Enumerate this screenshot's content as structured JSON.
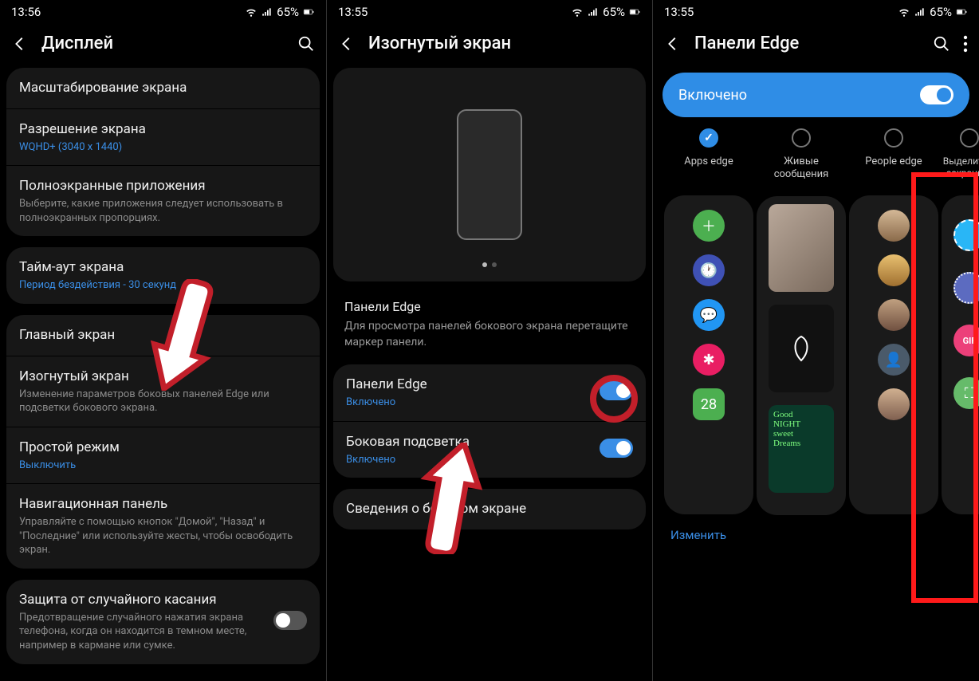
{
  "status": {
    "time1": "13:56",
    "time2": "13:55",
    "time3": "13:55",
    "battery": "65%"
  },
  "screen1": {
    "title": "Дисплей",
    "items": {
      "scaling": "Масштабирование экрана",
      "resolution": "Разрешение экрана",
      "resolution_sub": "WQHD+ (3040 x 1440)",
      "fullscreen": "Полноэкранные приложения",
      "fullscreen_sub": "Выберите, какие приложения следует использовать в полноэкранных пропорциях.",
      "timeout": "Тайм-аут экрана",
      "timeout_sub": "Период бездействия - 30 секунд",
      "home": "Главный экран",
      "edge": "Изогнутый экран",
      "edge_sub": "Изменение параметров боковых панелей Edge или подсветки бокового экрана.",
      "simple": "Простой режим",
      "simple_sub": "Выключить",
      "nav": "Навигационная панель",
      "nav_sub": "Управляйте с помощью кнопок \"Домой\", \"Назад\" и \"Последние\" или используйте жесты, чтобы освободить экран.",
      "accidental": "Защита от случайного касания",
      "accidental_sub": "Предотвращение случайного нажатия экрана телефона, когда он находится в темном месте, например в кармане или сумке."
    }
  },
  "screen2": {
    "title": "Изогнутый экран",
    "desc_title": "Панели Edge",
    "desc_text": "Для просмотра панелей бокового экрана перетащите маркер панели.",
    "panels": "Панели Edge",
    "panels_sub": "Включено",
    "lighting": "Боковая подсветка",
    "lighting_sub": "Включено",
    "about": "Сведения о боковом экране"
  },
  "screen3": {
    "title": "Панели Edge",
    "enabled": "Включено",
    "panels": [
      {
        "name": "Apps edge",
        "checked": true
      },
      {
        "name": "Живые сообщения",
        "checked": false
      },
      {
        "name": "People edge",
        "checked": false
      },
      {
        "name": "Выделить и сохранить",
        "checked": false
      }
    ],
    "edit": "Изменить"
  }
}
